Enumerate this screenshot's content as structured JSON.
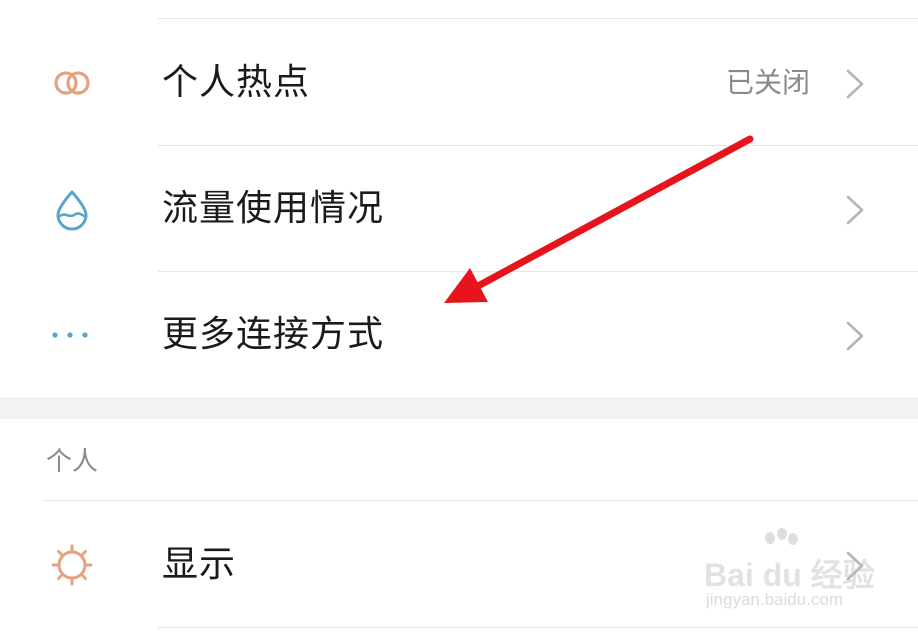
{
  "rows": [
    {
      "label": "个人热点",
      "value": "已关闭",
      "icon": "hotspot-rings-icon",
      "icon_color": "#e5a27e"
    },
    {
      "label": "流量使用情况",
      "value": "",
      "icon": "water-drop-icon",
      "icon_color": "#5aa6c8"
    },
    {
      "label": "更多连接方式",
      "value": "",
      "icon": "more-dots-icon",
      "icon_color": "#5aa6c8"
    }
  ],
  "section": {
    "title": "个人"
  },
  "section_rows": [
    {
      "label": "显示",
      "value": "",
      "icon": "brightness-sun-icon",
      "icon_color": "#e5a27e"
    }
  ],
  "annotation": {
    "color": "#e8141b"
  },
  "watermark": {
    "brand": "Bai du 经验",
    "url": "jingyan.baidu.com"
  },
  "colors": {
    "text": "#1a1a1a",
    "secondary": "#8a8a8a",
    "divider": "#e6e6e6",
    "section_bg": "#f2f2f2"
  }
}
